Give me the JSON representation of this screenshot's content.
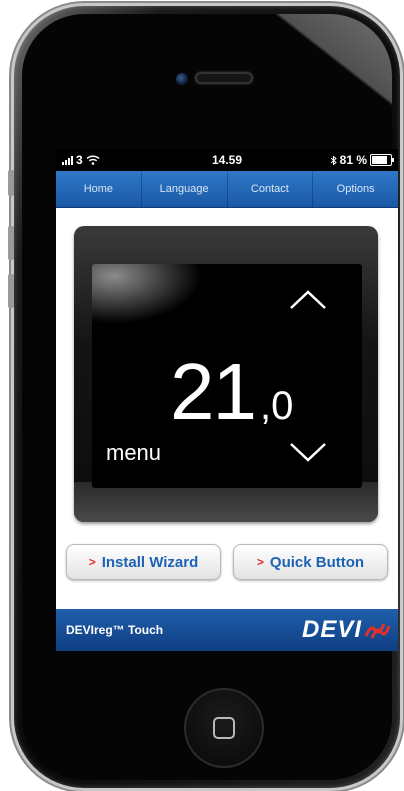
{
  "status_bar": {
    "carrier": "3",
    "time": "14.59",
    "battery": "81 %",
    "battery_level": 0.81,
    "icons": [
      "signal-icon",
      "wifi-icon",
      "bluetooth-icon",
      "battery-icon"
    ]
  },
  "nav": {
    "items": [
      {
        "label": "Home"
      },
      {
        "label": "Language"
      },
      {
        "label": "Contact"
      },
      {
        "label": "Options"
      }
    ]
  },
  "thermostat": {
    "temperature_whole": "21",
    "temperature_decimal": ",0",
    "menu_label": "menu",
    "up_icon": "chevron-up-icon",
    "down_icon": "chevron-down-icon"
  },
  "actions": {
    "install_wizard": "Install Wizard",
    "quick_button": "Quick Button",
    "chevron_glyph": ">"
  },
  "footer": {
    "product_name": "DEVIreg™ Touch",
    "brand_logo": "DEVI"
  },
  "colors": {
    "nav_blue": "#2f78c8",
    "footer_blue": "#1f5fac",
    "button_text": "#1d63b5",
    "accent_red": "#e0312a"
  }
}
